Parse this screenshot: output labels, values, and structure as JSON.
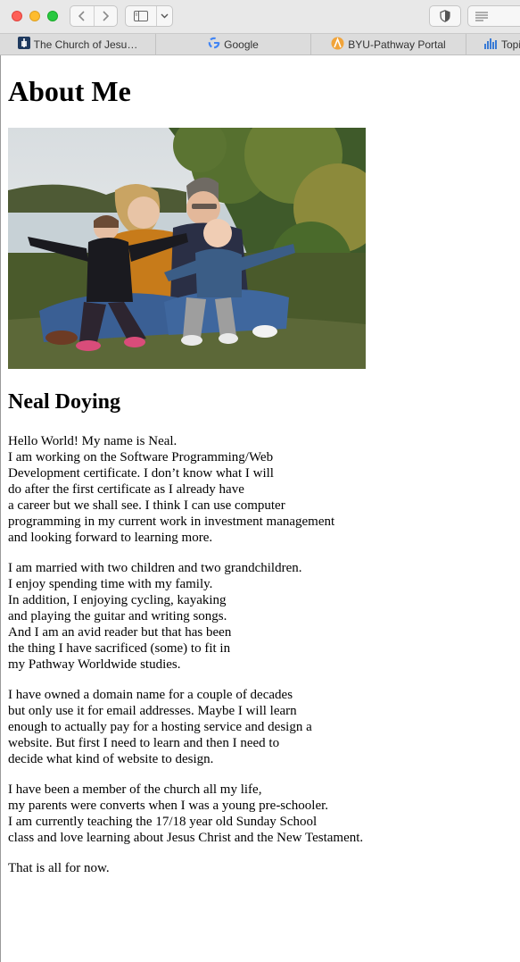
{
  "browser": {
    "tabs": [
      {
        "label": "The Church of Jesu…",
        "icon": "church-favicon"
      },
      {
        "label": "Google",
        "icon": "google-favicon"
      },
      {
        "label": "BYU-Pathway Portal",
        "icon": "pathway-favicon"
      },
      {
        "label": "Topi",
        "icon": "chart-favicon"
      }
    ]
  },
  "page": {
    "title": "About Me",
    "photo_alt": "Family photo: two adults and two young children sitting on grass by a lake",
    "name": "Neal Doying",
    "paragraphs": [
      "Hello World! My name is Neal.\nI am working on the Software Programming/Web\nDevelopment certificate. I don’t know what I will\ndo after the first certificate as I already have\na career but we shall see. I think I can use computer\nprogramming in my current work in investment management\nand looking forward to learning more.",
      "I am married with two children and two grandchildren.\nI enjoy spending time with my family.\nIn addition, I enjoying cycling, kayaking\nand playing the guitar and writing songs.\nAnd I am an avid reader but that has been\nthe thing I have sacrificed (some) to fit in\nmy Pathway Worldwide studies.",
      "I have owned a domain name for a couple of decades\nbut only use it for email addresses. Maybe I will learn\nenough to actually pay for a hosting service and design a\nwebsite. But first I need to learn and then I need to\ndecide what kind of website to design.",
      "I have been a member of the church all my life,\nmy parents were converts when I was a young pre-schooler.\nI am currently teaching the 17/18 year old Sunday School\nclass and love learning about Jesus Christ and the New Testament.",
      "That is all for now."
    ]
  }
}
